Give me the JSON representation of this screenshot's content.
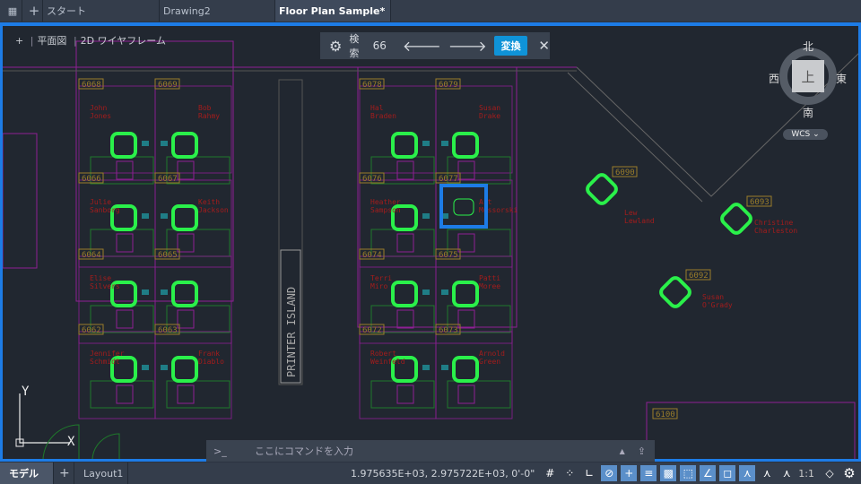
{
  "tabs": {
    "start": "スタート",
    "drawing2": "Drawing2",
    "active": "Floor Plan Sample*"
  },
  "view": {
    "plus": "+",
    "view_name": "平面図",
    "style": "2D ワイヤフレーム"
  },
  "find": {
    "label": "検索",
    "count": "66",
    "replace": "変換"
  },
  "viewcube": {
    "n": "北",
    "s": "南",
    "e": "東",
    "w": "西",
    "top": "上",
    "wcs": "WCS"
  },
  "plan": {
    "island": "PRINTER  ISLAND",
    "cubicles": [
      {
        "num": "6068",
        "name": [
          "John",
          "Jones"
        ]
      },
      {
        "num": "6069",
        "name": [
          "Bob",
          "Rahmy"
        ]
      },
      {
        "num": "6066",
        "name": [
          "Julie",
          "Sanborg"
        ]
      },
      {
        "num": "6067",
        "name": [
          "Keith",
          "Jackson"
        ]
      },
      {
        "num": "6064",
        "name": [
          "Elise",
          "Silvers"
        ]
      },
      {
        "num": "6065",
        "name": []
      },
      {
        "num": "6062",
        "name": [
          "Jennifer",
          "Schmidt"
        ]
      },
      {
        "num": "6063",
        "name": [
          "Frank",
          "Diablo"
        ]
      },
      {
        "num": "6078",
        "name": [
          "Hal",
          "Braden"
        ]
      },
      {
        "num": "6079",
        "name": [
          "Susan",
          "Drake"
        ]
      },
      {
        "num": "6076",
        "name": [
          "Heather",
          "Sampson"
        ]
      },
      {
        "num": "6077",
        "name": [
          "Art",
          "Mussorski"
        ]
      },
      {
        "num": "6074",
        "name": [
          "Terri",
          "Miro"
        ]
      },
      {
        "num": "6075",
        "name": [
          "Patti",
          "Moree"
        ]
      },
      {
        "num": "6072",
        "name": [
          "Robert",
          "Weinfeld"
        ]
      },
      {
        "num": "6073",
        "name": [
          "Arnold",
          "Green"
        ]
      },
      {
        "num": "6090",
        "name": [
          "Lew",
          "Lewland"
        ]
      },
      {
        "num": "6093",
        "name": [
          "Christine",
          "Charleston"
        ]
      },
      {
        "num": "6092",
        "name": [
          "Susan",
          "O'Grady"
        ]
      },
      {
        "num": "6100",
        "name": []
      }
    ]
  },
  "ucs": {
    "x": "X",
    "y": "Y"
  },
  "command": {
    "prompt": ">_",
    "placeholder": "ここにコマンドを入力"
  },
  "status": {
    "model": "モデル",
    "layout": "Layout1",
    "coords": "1.975635E+03, 2.975722E+03, 0'-0\"",
    "scale": "1:1"
  },
  "colors": {
    "accent": "#1d7ce6",
    "wall": "#8e1f94",
    "furniture": "#1f7a2b",
    "chair": "#2af04a",
    "label": "#9a7d2a",
    "name": "#a31c1c"
  }
}
